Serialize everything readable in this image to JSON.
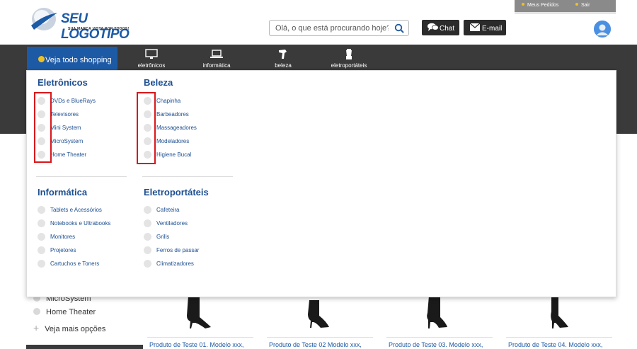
{
  "header": {
    "logo_text": "SEU LOGOTIPO",
    "logo_tagline": "SUA MARCA VISTA POR TODOS!",
    "top_links": {
      "orders": "Meus Pedidos",
      "exit": "Sair"
    },
    "search": {
      "placeholder": "Olá, o que está procurando hoje?",
      "value": ""
    },
    "chat_label": "Chat",
    "email_label": "E-mail"
  },
  "nav": {
    "shop_all": "Veja todo shopping",
    "items": [
      {
        "label": "eletrônicos",
        "icon": "monitor-icon"
      },
      {
        "label": "informática",
        "icon": "laptop-icon"
      },
      {
        "label": "beleza",
        "icon": "hair-dryer-icon"
      },
      {
        "label": "eletroportáteis",
        "icon": "blender-icon"
      }
    ]
  },
  "dropdown": {
    "categories": [
      {
        "title": "Eletrônicos",
        "items": [
          "DVDs e BlueRays",
          "Televisores",
          "Mini System",
          "MicroSystem",
          "Home Theater"
        ]
      },
      {
        "title": "Beleza",
        "items": [
          "Chapinha",
          "Barbeadores",
          "Massageadores",
          "Modeladores",
          "Higiene Bucal"
        ]
      },
      {
        "title": "Informática",
        "items": [
          "Tablets e Acessórios",
          "Notebooks e Ultrabooks",
          "Monitores",
          "Projetores",
          "Cartuchos e Toners"
        ]
      },
      {
        "title": "Eletroportáteis",
        "items": [
          "Cafeteira",
          "Ventiladores",
          "Grills",
          "Ferros de passar",
          "Climatizadores"
        ]
      }
    ]
  },
  "sidebar": {
    "items": [
      "MicroSystem",
      "Home Theater"
    ],
    "more": "Veja mais opções"
  },
  "products": [
    {
      "name": "Produto de Teste 01. Modelo xxx,"
    },
    {
      "name": "Produto de Teste 02 Modelo xxx,"
    },
    {
      "name": "Produto de Teste 03. Modelo xxx,"
    },
    {
      "name": "Produto de Teste 04. Modelo xxx,"
    }
  ],
  "colors": {
    "brand_blue": "#1d5aa6",
    "dark_bar": "#3a3a3a",
    "highlight_red": "#d9171b",
    "accent_yellow": "#f0c020"
  }
}
